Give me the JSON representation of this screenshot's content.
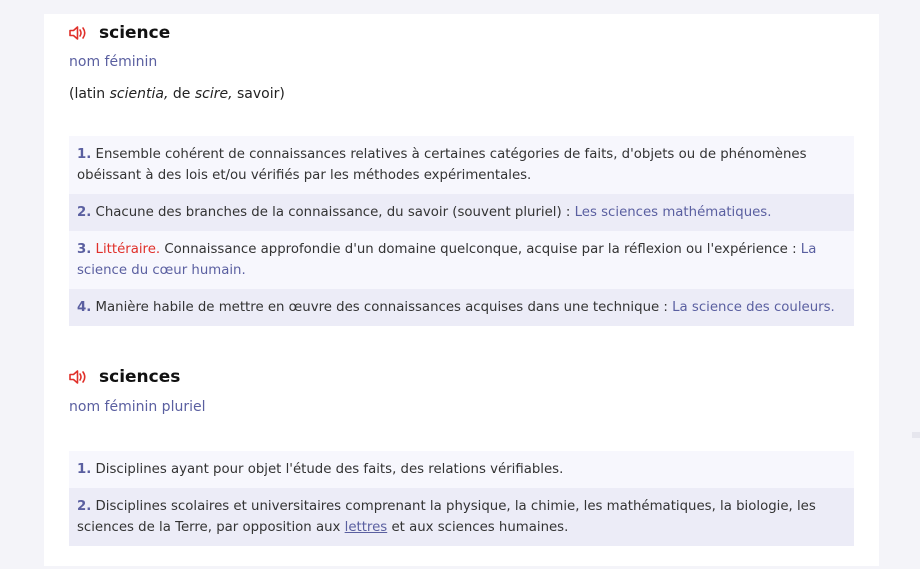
{
  "colors": {
    "speaker_icon": "#e0302a",
    "accent": "#5a5fa0",
    "domain": "#e0302a",
    "row_light": "#f7f7fd",
    "row_dark": "#ececf7"
  },
  "entries": [
    {
      "headword": "science",
      "pos": "nom féminin",
      "etymology": {
        "prefix": "(latin ",
        "word1": "scientia,",
        "mid": " de ",
        "word2": "scire,",
        "suffix": " savoir)"
      },
      "definitions": [
        {
          "num": "1.",
          "text": " Ensemble cohérent de connaissances relatives à certaines catégories de faits, d'objets ou de phénomènes obéissant à des lois et/ou vérifiés par les méthodes expérimentales."
        },
        {
          "num": "2.",
          "text": " Chacune des branches de la connaissance, du savoir (souvent pluriel) : ",
          "example": "Les sciences mathématiques."
        },
        {
          "num": "3.",
          "domain": " Littéraire.",
          "text": " Connaissance approfondie d'un domaine quelconque, acquise par la réflexion ou l'expérience : ",
          "example": "La science du cœur humain."
        },
        {
          "num": "4.",
          "text": " Manière habile de mettre en œuvre des connaissances acquises dans une technique : ",
          "example": "La science des couleurs."
        }
      ]
    },
    {
      "headword": "sciences",
      "pos": "nom féminin pluriel",
      "definitions": [
        {
          "num": "1.",
          "text": " Disciplines ayant pour objet l'étude des faits, des relations vérifiables."
        },
        {
          "num": "2.",
          "text": " Disciplines scolaires et universitaires comprenant la physique, la chimie, les mathématiques, la biologie, les sciences de la Terre, par opposition aux ",
          "link": "lettres",
          "text_after": " et aux sciences humaines."
        }
      ]
    }
  ]
}
